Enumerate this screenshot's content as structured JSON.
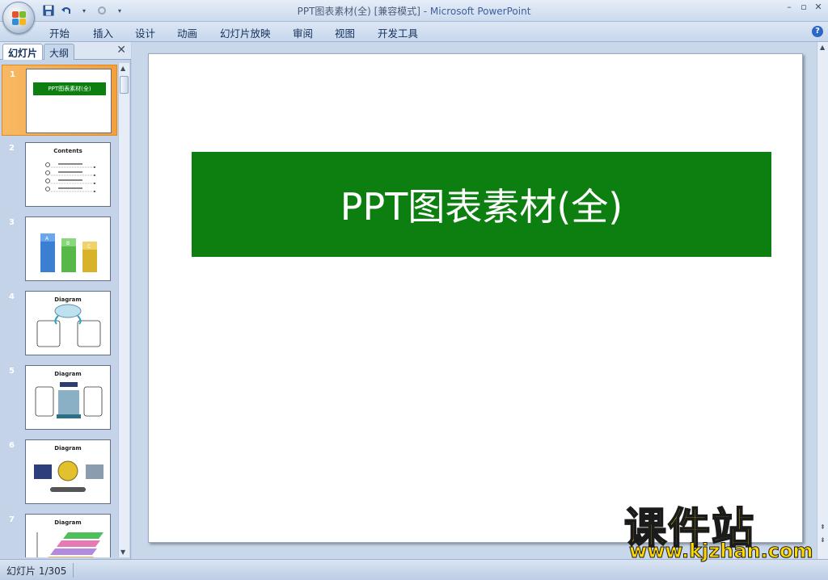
{
  "window": {
    "title": "PPT图表素材(全) [兼容模式] - ",
    "app_name": "Microsoft PowerPoint"
  },
  "quick_access": {
    "save_icon": "save-icon",
    "undo_icon": "undo-icon",
    "redo_icon": "redo-icon",
    "customize_icon": "customize-icon"
  },
  "ribbon_tabs": [
    "开始",
    "插入",
    "设计",
    "动画",
    "幻灯片放映",
    "审阅",
    "视图",
    "开发工具"
  ],
  "left_pane": {
    "tab_slides": "幻灯片",
    "tab_outline": "大纲",
    "thumbnails": [
      {
        "number": "1",
        "label": "PPT图表素材(全)"
      },
      {
        "number": "2",
        "label": "Contents"
      },
      {
        "number": "3",
        "label": ""
      },
      {
        "number": "4",
        "label": "Diagram"
      },
      {
        "number": "5",
        "label": "Diagram"
      },
      {
        "number": "6",
        "label": "Diagram"
      },
      {
        "number": "7",
        "label": "Diagram"
      }
    ]
  },
  "slide": {
    "title": "PPT图表素材(全)"
  },
  "status_bar": {
    "slide_info": "幻灯片 1/305"
  },
  "watermark": {
    "title": "课件站",
    "url": "www.kjzhan.com"
  },
  "colors": {
    "banner_green": "#0d7f11",
    "selected_thumb": "#f59f3b",
    "watermark_yellow": "#ffd800"
  }
}
